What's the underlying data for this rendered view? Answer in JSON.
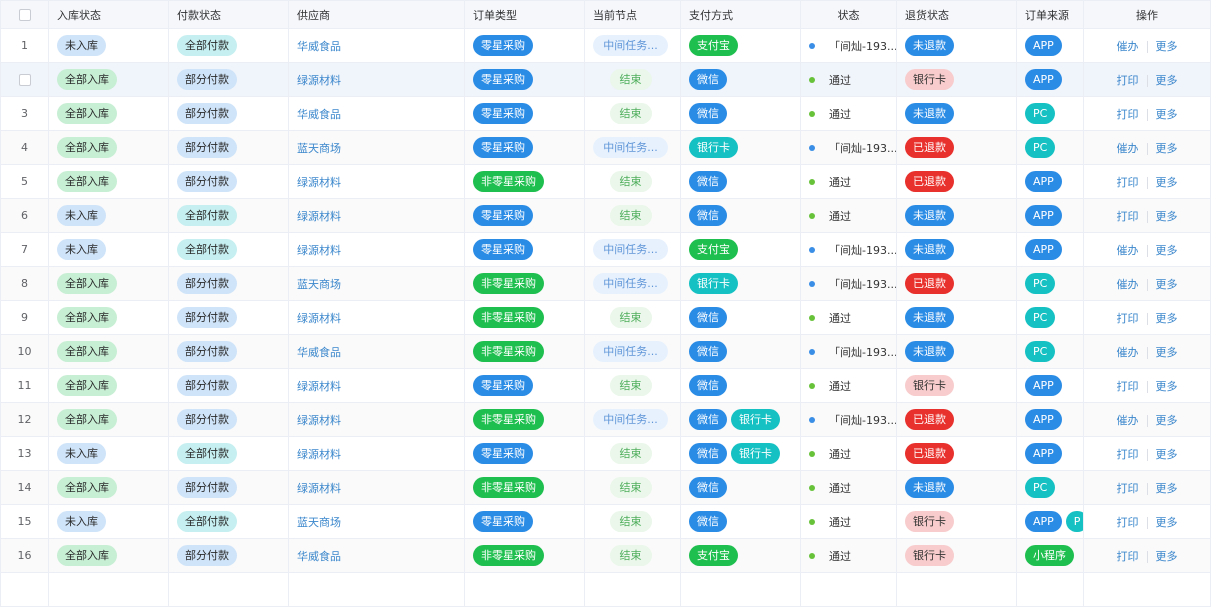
{
  "headers": [
    "入库状态",
    "付款状态",
    "供应商",
    "订单类型",
    "当前节点",
    "支付方式",
    "状态",
    "退货状态",
    "订单来源",
    "操作"
  ],
  "labels": {
    "node_mid": "中间任务...",
    "node_end": "结束",
    "status_pass": "通过",
    "status_flow": "「间灿-193...",
    "op_handle": "催办",
    "op_print": "打印",
    "op_more": "更多"
  },
  "rows": [
    {
      "idx": "1",
      "in": "未入库",
      "pay": "全部付款",
      "supplier": "华威食品",
      "type": "零星采购",
      "node": "中间任务...",
      "methods": [
        "支付宝"
      ],
      "status": "「间灿-193...",
      "refund": "未退款",
      "sources": [
        "APP"
      ],
      "op": "催办"
    },
    {
      "idx": "",
      "in": "全部入库",
      "pay": "部分付款",
      "supplier": "绿源材料",
      "type": "零星采购",
      "node": "结束",
      "methods": [
        "微信"
      ],
      "status": "通过",
      "refund": "银行卡",
      "sources": [
        "APP"
      ],
      "op": "打印"
    },
    {
      "idx": "3",
      "in": "全部入库",
      "pay": "部分付款",
      "supplier": "华威食品",
      "type": "零星采购",
      "node": "结束",
      "methods": [
        "微信"
      ],
      "status": "通过",
      "refund": "未退款",
      "sources": [
        "PC"
      ],
      "op": "打印"
    },
    {
      "idx": "4",
      "in": "全部入库",
      "pay": "部分付款",
      "supplier": "蓝天商场",
      "type": "零星采购",
      "node": "中间任务...",
      "methods": [
        "银行卡"
      ],
      "status": "「间灿-193...",
      "refund": "已退款",
      "sources": [
        "PC"
      ],
      "op": "催办"
    },
    {
      "idx": "5",
      "in": "全部入库",
      "pay": "部分付款",
      "supplier": "绿源材料",
      "type": "非零星采购",
      "node": "结束",
      "methods": [
        "微信"
      ],
      "status": "通过",
      "refund": "已退款",
      "sources": [
        "APP"
      ],
      "op": "打印"
    },
    {
      "idx": "6",
      "in": "未入库",
      "pay": "全部付款",
      "supplier": "绿源材料",
      "type": "零星采购",
      "node": "结束",
      "methods": [
        "微信"
      ],
      "status": "通过",
      "refund": "未退款",
      "sources": [
        "APP"
      ],
      "op": "打印"
    },
    {
      "idx": "7",
      "in": "未入库",
      "pay": "全部付款",
      "supplier": "绿源材料",
      "type": "零星采购",
      "node": "中间任务...",
      "methods": [
        "支付宝"
      ],
      "status": "「间灿-193...",
      "refund": "未退款",
      "sources": [
        "APP"
      ],
      "op": "催办"
    },
    {
      "idx": "8",
      "in": "全部入库",
      "pay": "部分付款",
      "supplier": "蓝天商场",
      "type": "非零星采购",
      "node": "中间任务...",
      "methods": [
        "银行卡"
      ],
      "status": "「间灿-193...",
      "refund": "已退款",
      "sources": [
        "PC"
      ],
      "op": "催办"
    },
    {
      "idx": "9",
      "in": "全部入库",
      "pay": "部分付款",
      "supplier": "绿源材料",
      "type": "非零星采购",
      "node": "结束",
      "methods": [
        "微信"
      ],
      "status": "通过",
      "refund": "未退款",
      "sources": [
        "PC"
      ],
      "op": "打印"
    },
    {
      "idx": "10",
      "in": "全部入库",
      "pay": "部分付款",
      "supplier": "华威食品",
      "type": "非零星采购",
      "node": "中间任务...",
      "methods": [
        "微信"
      ],
      "status": "「间灿-193...",
      "refund": "未退款",
      "sources": [
        "PC"
      ],
      "op": "催办"
    },
    {
      "idx": "11",
      "in": "全部入库",
      "pay": "部分付款",
      "supplier": "绿源材料",
      "type": "零星采购",
      "node": "结束",
      "methods": [
        "微信"
      ],
      "status": "通过",
      "refund": "银行卡",
      "sources": [
        "APP"
      ],
      "op": "打印"
    },
    {
      "idx": "12",
      "in": "全部入库",
      "pay": "部分付款",
      "supplier": "绿源材料",
      "type": "非零星采购",
      "node": "中间任务...",
      "methods": [
        "微信",
        "银行卡"
      ],
      "status": "「间灿-193...",
      "refund": "已退款",
      "sources": [
        "APP"
      ],
      "op": "催办"
    },
    {
      "idx": "13",
      "in": "未入库",
      "pay": "全部付款",
      "supplier": "绿源材料",
      "type": "零星采购",
      "node": "结束",
      "methods": [
        "微信",
        "银行卡"
      ],
      "status": "通过",
      "refund": "已退款",
      "sources": [
        "APP"
      ],
      "op": "打印"
    },
    {
      "idx": "14",
      "in": "全部入库",
      "pay": "部分付款",
      "supplier": "绿源材料",
      "type": "非零星采购",
      "node": "结束",
      "methods": [
        "微信"
      ],
      "status": "通过",
      "refund": "未退款",
      "sources": [
        "PC"
      ],
      "op": "打印"
    },
    {
      "idx": "15",
      "in": "未入库",
      "pay": "全部付款",
      "supplier": "蓝天商场",
      "type": "零星采购",
      "node": "结束",
      "methods": [
        "微信"
      ],
      "status": "通过",
      "refund": "银行卡",
      "sources": [
        "APP",
        "P"
      ],
      "op": "打印"
    },
    {
      "idx": "16",
      "in": "全部入库",
      "pay": "部分付款",
      "supplier": "华威食品",
      "type": "非零星采购",
      "node": "结束",
      "methods": [
        "支付宝"
      ],
      "status": "通过",
      "refund": "银行卡",
      "sources": [
        "小程序"
      ],
      "op": "打印"
    }
  ]
}
